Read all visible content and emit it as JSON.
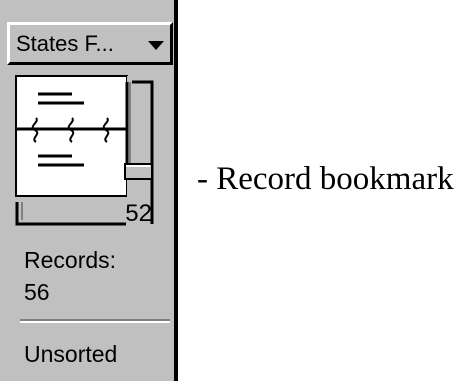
{
  "status_area": {
    "layout_menu": {
      "label": "States F...",
      "icon": "chevron-down-icon"
    },
    "book": {
      "icon": "book-icon",
      "current_record": "52"
    },
    "records": {
      "label": "Records:",
      "count": "56"
    },
    "sort_status": "Unsorted"
  },
  "annotation": {
    "text": "- Record bookmark"
  }
}
